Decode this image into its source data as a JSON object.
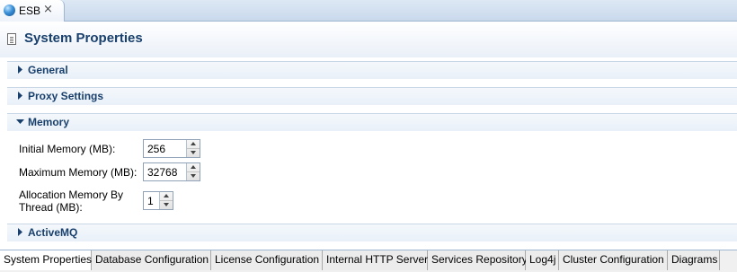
{
  "editor_tab": {
    "label": "ESB",
    "close_symbol": "⨯"
  },
  "header": {
    "title": "System Properties"
  },
  "sections": {
    "general": {
      "label": "General",
      "expanded": false
    },
    "proxy": {
      "label": "Proxy Settings",
      "expanded": false
    },
    "memory": {
      "label": "Memory",
      "expanded": true
    },
    "activemq": {
      "label": "ActiveMQ",
      "expanded": false
    }
  },
  "memory_fields": {
    "initial": {
      "label": "Initial Memory (MB):",
      "value": "256"
    },
    "maximum": {
      "label": "Maximum Memory (MB):",
      "value": "32768"
    },
    "allocation": {
      "label_line1": "Allocation Memory By",
      "label_line2": "Thread (MB):",
      "value": "1"
    }
  },
  "bottom_tabs": [
    {
      "label": "System Properties",
      "active": true
    },
    {
      "label": "Database Configuration",
      "active": false
    },
    {
      "label": "License Configuration",
      "active": false
    },
    {
      "label": "Internal HTTP Server",
      "active": false
    },
    {
      "label": "Services Repository",
      "active": false
    },
    {
      "label": "Log4j",
      "active": false
    },
    {
      "label": "Cluster Configuration",
      "active": false
    },
    {
      "label": "Diagrams",
      "active": false
    }
  ],
  "colors": {
    "section_title": "#19406d",
    "tab_border": "#9fb6d2"
  }
}
